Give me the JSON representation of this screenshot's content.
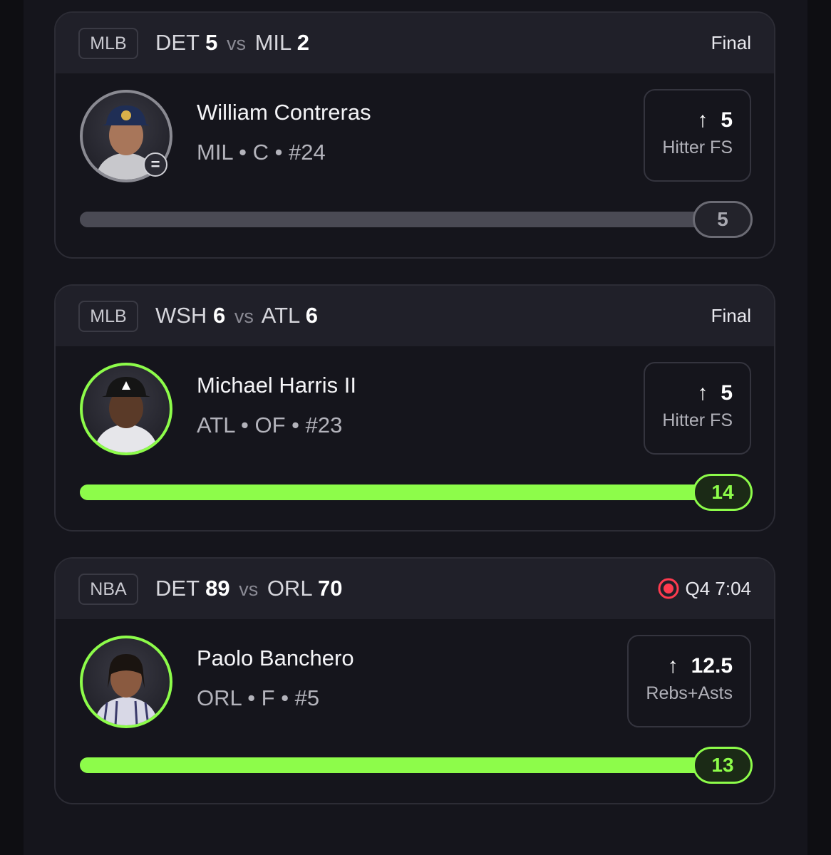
{
  "colors": {
    "accent_green": "#8dfc4a",
    "live_red": "#ff3b4f",
    "card_bg": "#15151c",
    "header_bg": "#202029"
  },
  "cards": [
    {
      "league": "MLB",
      "away_team": "DET",
      "away_score": "5",
      "vs": "vs",
      "home_team": "MIL",
      "home_score": "2",
      "status": "Final",
      "live": false,
      "player_name": "William Contreras",
      "player_meta": "MIL • C • #24",
      "status_chip_icon": "equals-icon",
      "status_chip_text": "=",
      "direction_icon": "arrow-up-icon",
      "direction_glyph": "↑",
      "line": "5",
      "stat_type": "Hitter FS",
      "result": "5",
      "progress_fraction": 1.0,
      "hit": false
    },
    {
      "league": "MLB",
      "away_team": "WSH",
      "away_score": "6",
      "vs": "vs",
      "home_team": "ATL",
      "home_score": "6",
      "status": "Final",
      "live": false,
      "player_name": "Michael Harris II",
      "player_meta": "ATL • OF • #23",
      "direction_icon": "arrow-up-icon",
      "direction_glyph": "↑",
      "line": "5",
      "stat_type": "Hitter FS",
      "result": "14",
      "progress_fraction": 1.0,
      "hit": true
    },
    {
      "league": "NBA",
      "away_team": "DET",
      "away_score": "89",
      "vs": "vs",
      "home_team": "ORL",
      "home_score": "70",
      "status": "Q4 7:04",
      "live": true,
      "live_icon": "live-record-icon",
      "player_name": "Paolo Banchero",
      "player_meta": "ORL • F • #5",
      "direction_icon": "arrow-up-icon",
      "direction_glyph": "↑",
      "line": "12.5",
      "stat_type": "Rebs+Asts",
      "result": "13",
      "progress_fraction": 1.0,
      "hit": true
    }
  ]
}
